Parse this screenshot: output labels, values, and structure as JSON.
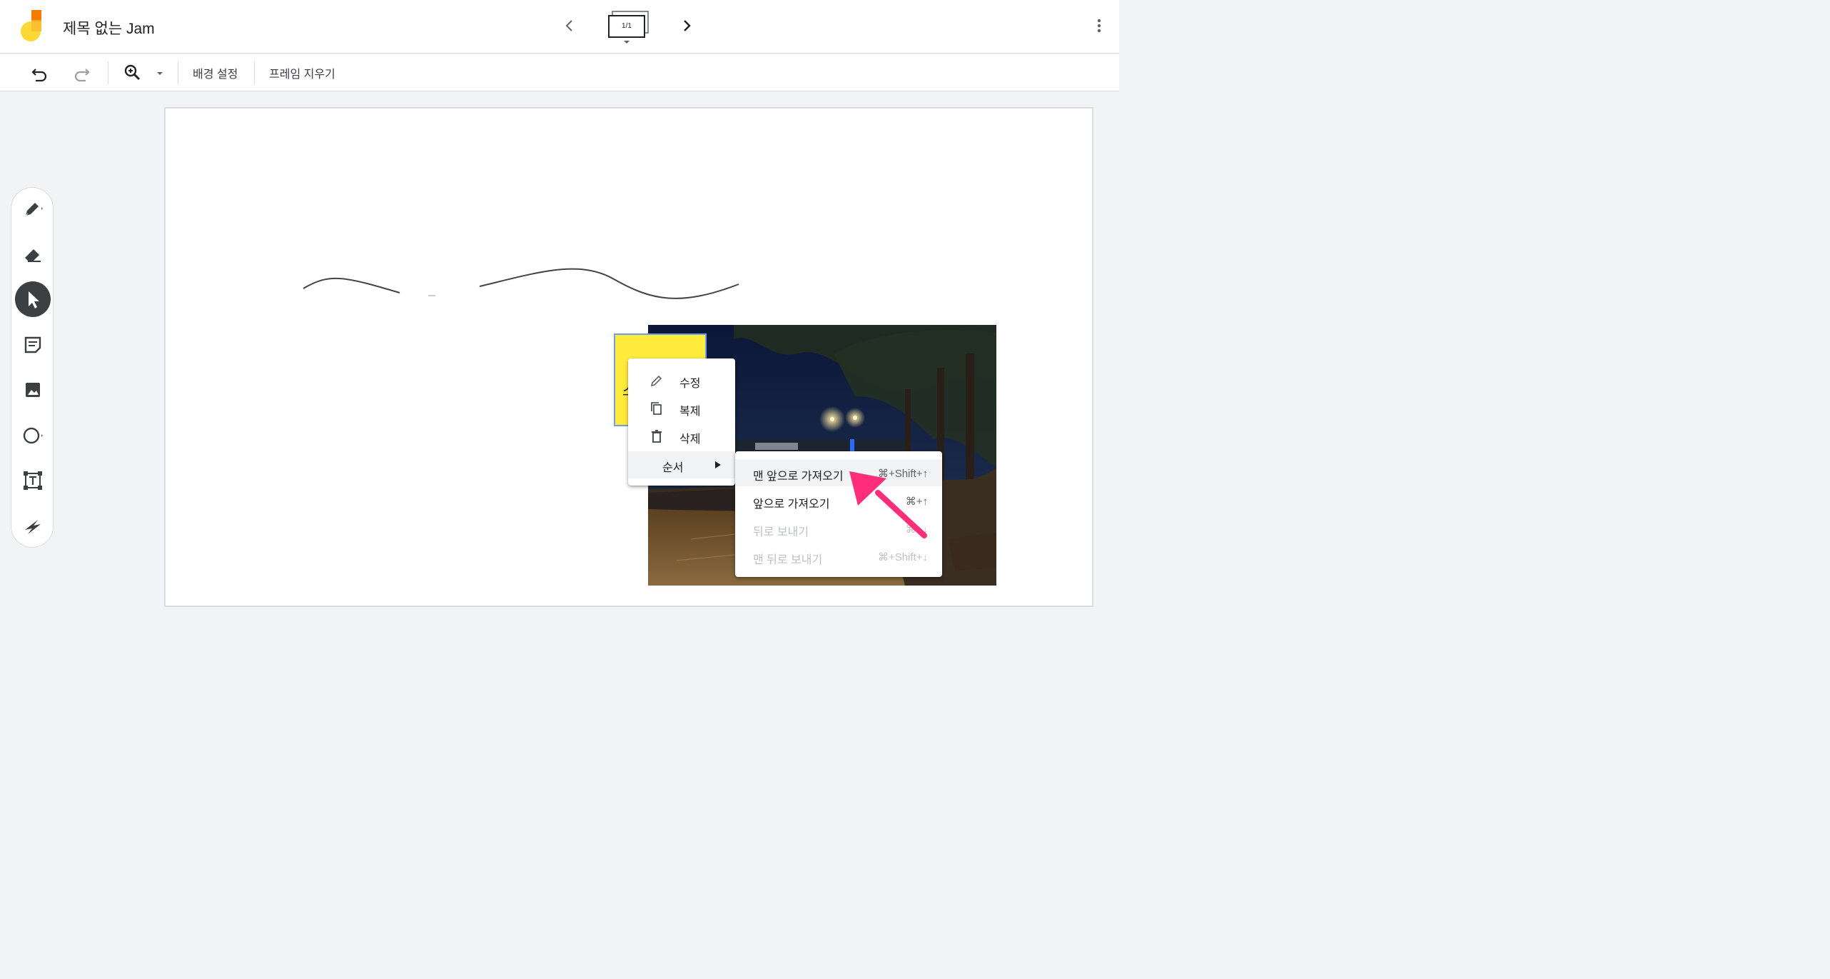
{
  "app": {
    "title": "제목 없는 Jam",
    "frame_indicator": "1/1"
  },
  "toolbar": {
    "background_label": "배경 설정",
    "clear_frame_label": "프레임 지우기"
  },
  "tools": [
    {
      "name": "pen-tool",
      "icon": "pen-icon"
    },
    {
      "name": "eraser-tool",
      "icon": "eraser-icon"
    },
    {
      "name": "select-tool",
      "icon": "cursor-icon",
      "active": true
    },
    {
      "name": "sticky-note-tool",
      "icon": "sticky-note-icon"
    },
    {
      "name": "image-tool",
      "icon": "image-icon"
    },
    {
      "name": "shape-tool",
      "icon": "circle-icon"
    },
    {
      "name": "text-box-tool",
      "icon": "text-box-icon"
    },
    {
      "name": "laser-tool",
      "icon": "laser-icon"
    }
  ],
  "sticky_note": {
    "text": "스"
  },
  "context_menu": {
    "items": [
      {
        "label": "수정",
        "icon": "pencil-icon"
      },
      {
        "label": "복제",
        "icon": "copy-icon"
      },
      {
        "label": "삭제",
        "icon": "trash-icon"
      },
      {
        "label": "순서",
        "icon": "submenu-arrow-icon"
      }
    ]
  },
  "order_submenu": {
    "items": [
      {
        "label": "맨 앞으로 가져오기",
        "shortcut": "⌘+Shift+↑",
        "enabled": true
      },
      {
        "label": "앞으로 가져오기",
        "shortcut": "⌘+↑",
        "enabled": true
      },
      {
        "label": "뒤로 보내기",
        "shortcut": "⌘+↓",
        "enabled": false
      },
      {
        "label": "맨 뒤로 보내기",
        "shortcut": "⌘+Shift+↓",
        "enabled": false
      }
    ]
  },
  "colors": {
    "accent_pink": "#ff2d7a",
    "sticky_yellow": "#ffeb3b",
    "selection_blue": "#6d9eeb",
    "logo_orange": "#f57c00",
    "logo_yellow": "#fdd835"
  }
}
